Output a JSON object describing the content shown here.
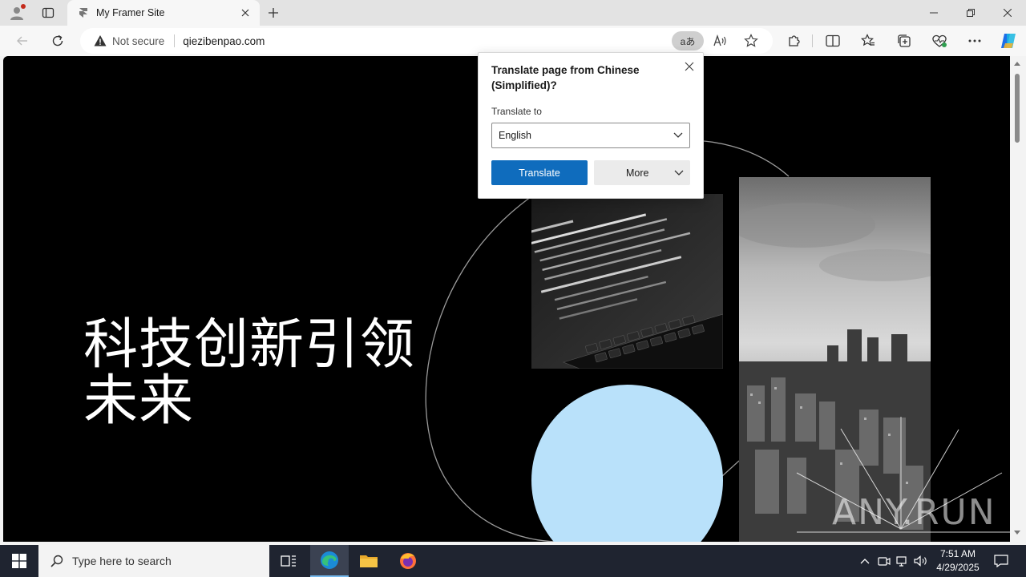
{
  "browser": {
    "tab_title": "My Framer Site",
    "address": {
      "security_label": "Not secure",
      "url": "qiezibenpao.com",
      "translate_glyph": "aあ"
    }
  },
  "page": {
    "headline": "科技创新引领未来",
    "headline_line2": "来",
    "watermark": "ANY.RUN"
  },
  "translate_popup": {
    "title": "Translate page from Chinese (Simplified)?",
    "label": "Translate to",
    "selected_language": "English",
    "translate_button": "Translate",
    "more_button": "More"
  },
  "taskbar": {
    "search_placeholder": "Type here to search",
    "time": "7:51 AM",
    "date": "4/29/2025"
  },
  "colors": {
    "accent": "#0f6cbd",
    "circle": "#b9e1fa",
    "taskbar": "#1f2430"
  }
}
